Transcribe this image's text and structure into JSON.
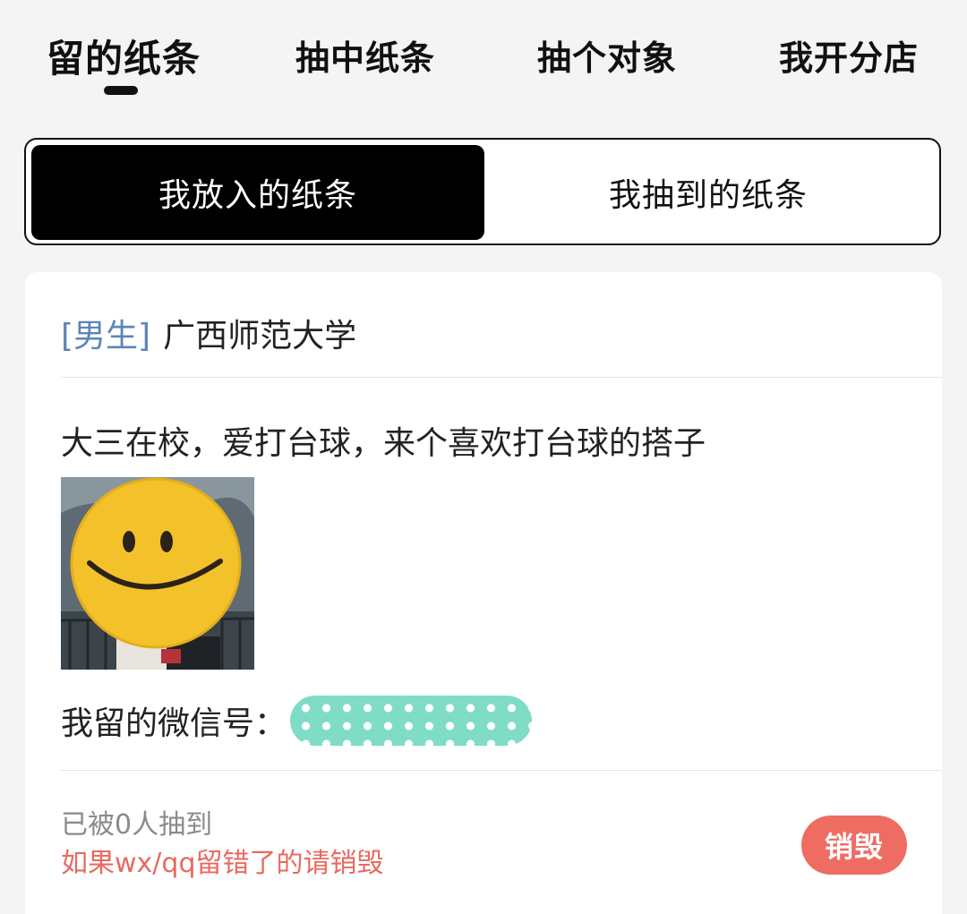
{
  "top_tabs": [
    {
      "label": "留的纸条",
      "active": true
    },
    {
      "label": "抽中纸条",
      "active": false
    },
    {
      "label": "抽个对象",
      "active": false
    },
    {
      "label": "我开分店",
      "active": false
    }
  ],
  "segmented": {
    "options": [
      "我放入的纸条",
      "我抽到的纸条"
    ],
    "selected": "我放入的纸条"
  },
  "note": {
    "gender_tag": "[男生]",
    "school": "广西师范大学",
    "text": "大三在校，爱打台球，来个喜欢打台球的搭子",
    "photo_icon": "smiley-face-sticker",
    "wechat_label": "我留的微信号：",
    "wechat_value_masked": true,
    "draw_count_text": "已被0人抽到",
    "hint_text": "如果wx/qq留错了的请销毁",
    "destroy_label": "销毁"
  },
  "colors": {
    "background": "#f4f4f4",
    "active_segment": "#000000",
    "gender_tag": "#5a86b8",
    "hint": "#e86a5f",
    "destroy_button": "#ee6c62",
    "mask": "#7fdcc6"
  }
}
